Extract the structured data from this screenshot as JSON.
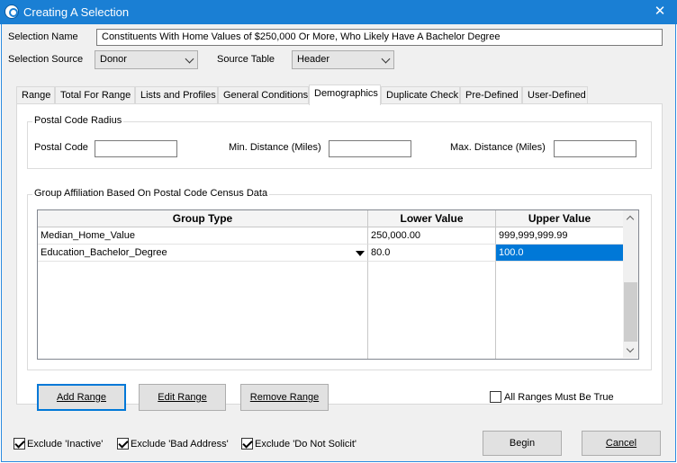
{
  "window": {
    "title": "Creating A Selection",
    "close_glyph": "✕"
  },
  "selection_name": {
    "label": "Selection Name",
    "value": "Constituents With Home Values of $250,000 Or More, Who Likely Have A Bachelor Degree"
  },
  "selection_source": {
    "label": "Selection Source",
    "value": "Donor"
  },
  "source_table": {
    "label": "Source Table",
    "value": "Header"
  },
  "tabs": [
    {
      "label": "Range"
    },
    {
      "label": "Total For Range"
    },
    {
      "label": "Lists and Profiles"
    },
    {
      "label": "General Conditions"
    },
    {
      "label": "Demographics",
      "active": true
    },
    {
      "label": "Duplicate Check"
    },
    {
      "label": "Pre-Defined"
    },
    {
      "label": "User-Defined"
    }
  ],
  "postal_radius": {
    "title": "Postal Code Radius",
    "postal_code_label": "Postal Code",
    "postal_code_value": "",
    "min_distance_label": "Min. Distance (Miles)",
    "min_distance_value": "",
    "max_distance_label": "Max. Distance (Miles)",
    "max_distance_value": ""
  },
  "group_affiliation": {
    "title": "Group Affiliation Based On Postal Code Census Data",
    "columns": [
      "Group Type",
      "Lower Value",
      "Upper Value"
    ],
    "rows": [
      {
        "group_type": "Median_Home_Value",
        "lower": "250,000.00",
        "upper": "999,999,999.99"
      },
      {
        "group_type": "Education_Bachelor_Degree",
        "lower": "80.0",
        "upper": "100.0"
      }
    ]
  },
  "buttons": {
    "add_range": "Add Range",
    "edit_range": "Edit Range",
    "remove_range": "Remove Range",
    "begin": "Begin",
    "cancel": "Cancel"
  },
  "all_ranges_true": {
    "label": "All Ranges Must Be True",
    "checked": false
  },
  "excludes": [
    {
      "label": "Exclude 'Inactive'",
      "checked": true
    },
    {
      "label": "Exclude 'Bad Address'",
      "checked": true
    },
    {
      "label": "Exclude 'Do Not Solicit'",
      "checked": true
    }
  ],
  "colors": {
    "titlebar": "#1a7fd4",
    "selection": "#0078d7",
    "default_button_border": "#0078d7"
  }
}
